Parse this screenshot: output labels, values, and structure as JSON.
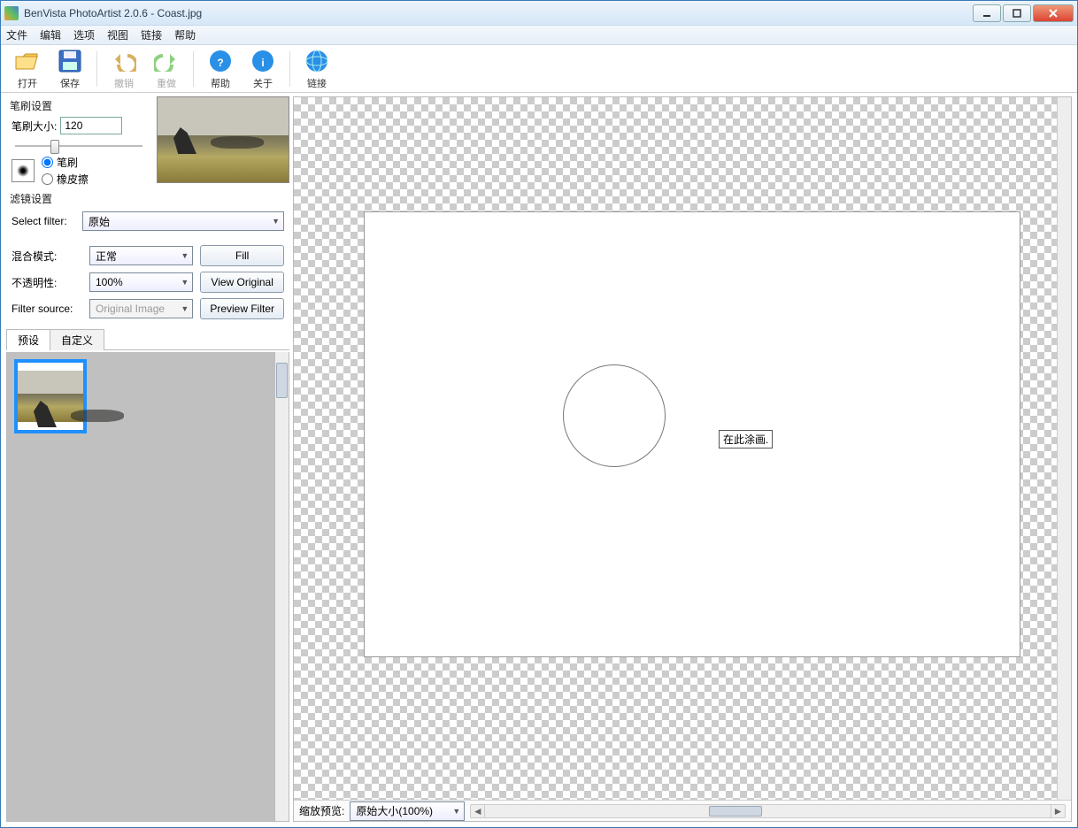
{
  "window": {
    "title": "BenVista PhotoArtist 2.0.6 - Coast.jpg"
  },
  "menu": [
    "文件",
    "编辑",
    "选项",
    "视图",
    "链接",
    "帮助"
  ],
  "toolbar": {
    "open": "打开",
    "save": "保存",
    "undo": "撤销",
    "redo": "重做",
    "help": "帮助",
    "about": "关于",
    "link": "链接"
  },
  "brush": {
    "section": "笔刷设置",
    "size_label": "笔刷大小:",
    "size_value": "120",
    "tool_brush": "笔刷",
    "tool_eraser": "橡皮擦"
  },
  "filter": {
    "section": "滤镜设置",
    "select_label": "Select filter:",
    "select_value": "原始",
    "blend_label": "混合模式:",
    "blend_value": "正常",
    "opacity_label": "不透明性:",
    "opacity_value": "100%",
    "source_label": "Filter source:",
    "source_value": "Original Image",
    "fill_btn": "Fill",
    "view_btn": "View Original",
    "preview_btn": "Preview Filter"
  },
  "tabs": {
    "preset": "预设",
    "custom": "自定义"
  },
  "canvas": {
    "tooltip": "在此涂画."
  },
  "status": {
    "zoom_label": "缩放预览:",
    "zoom_value": "原始大小(100%)"
  }
}
